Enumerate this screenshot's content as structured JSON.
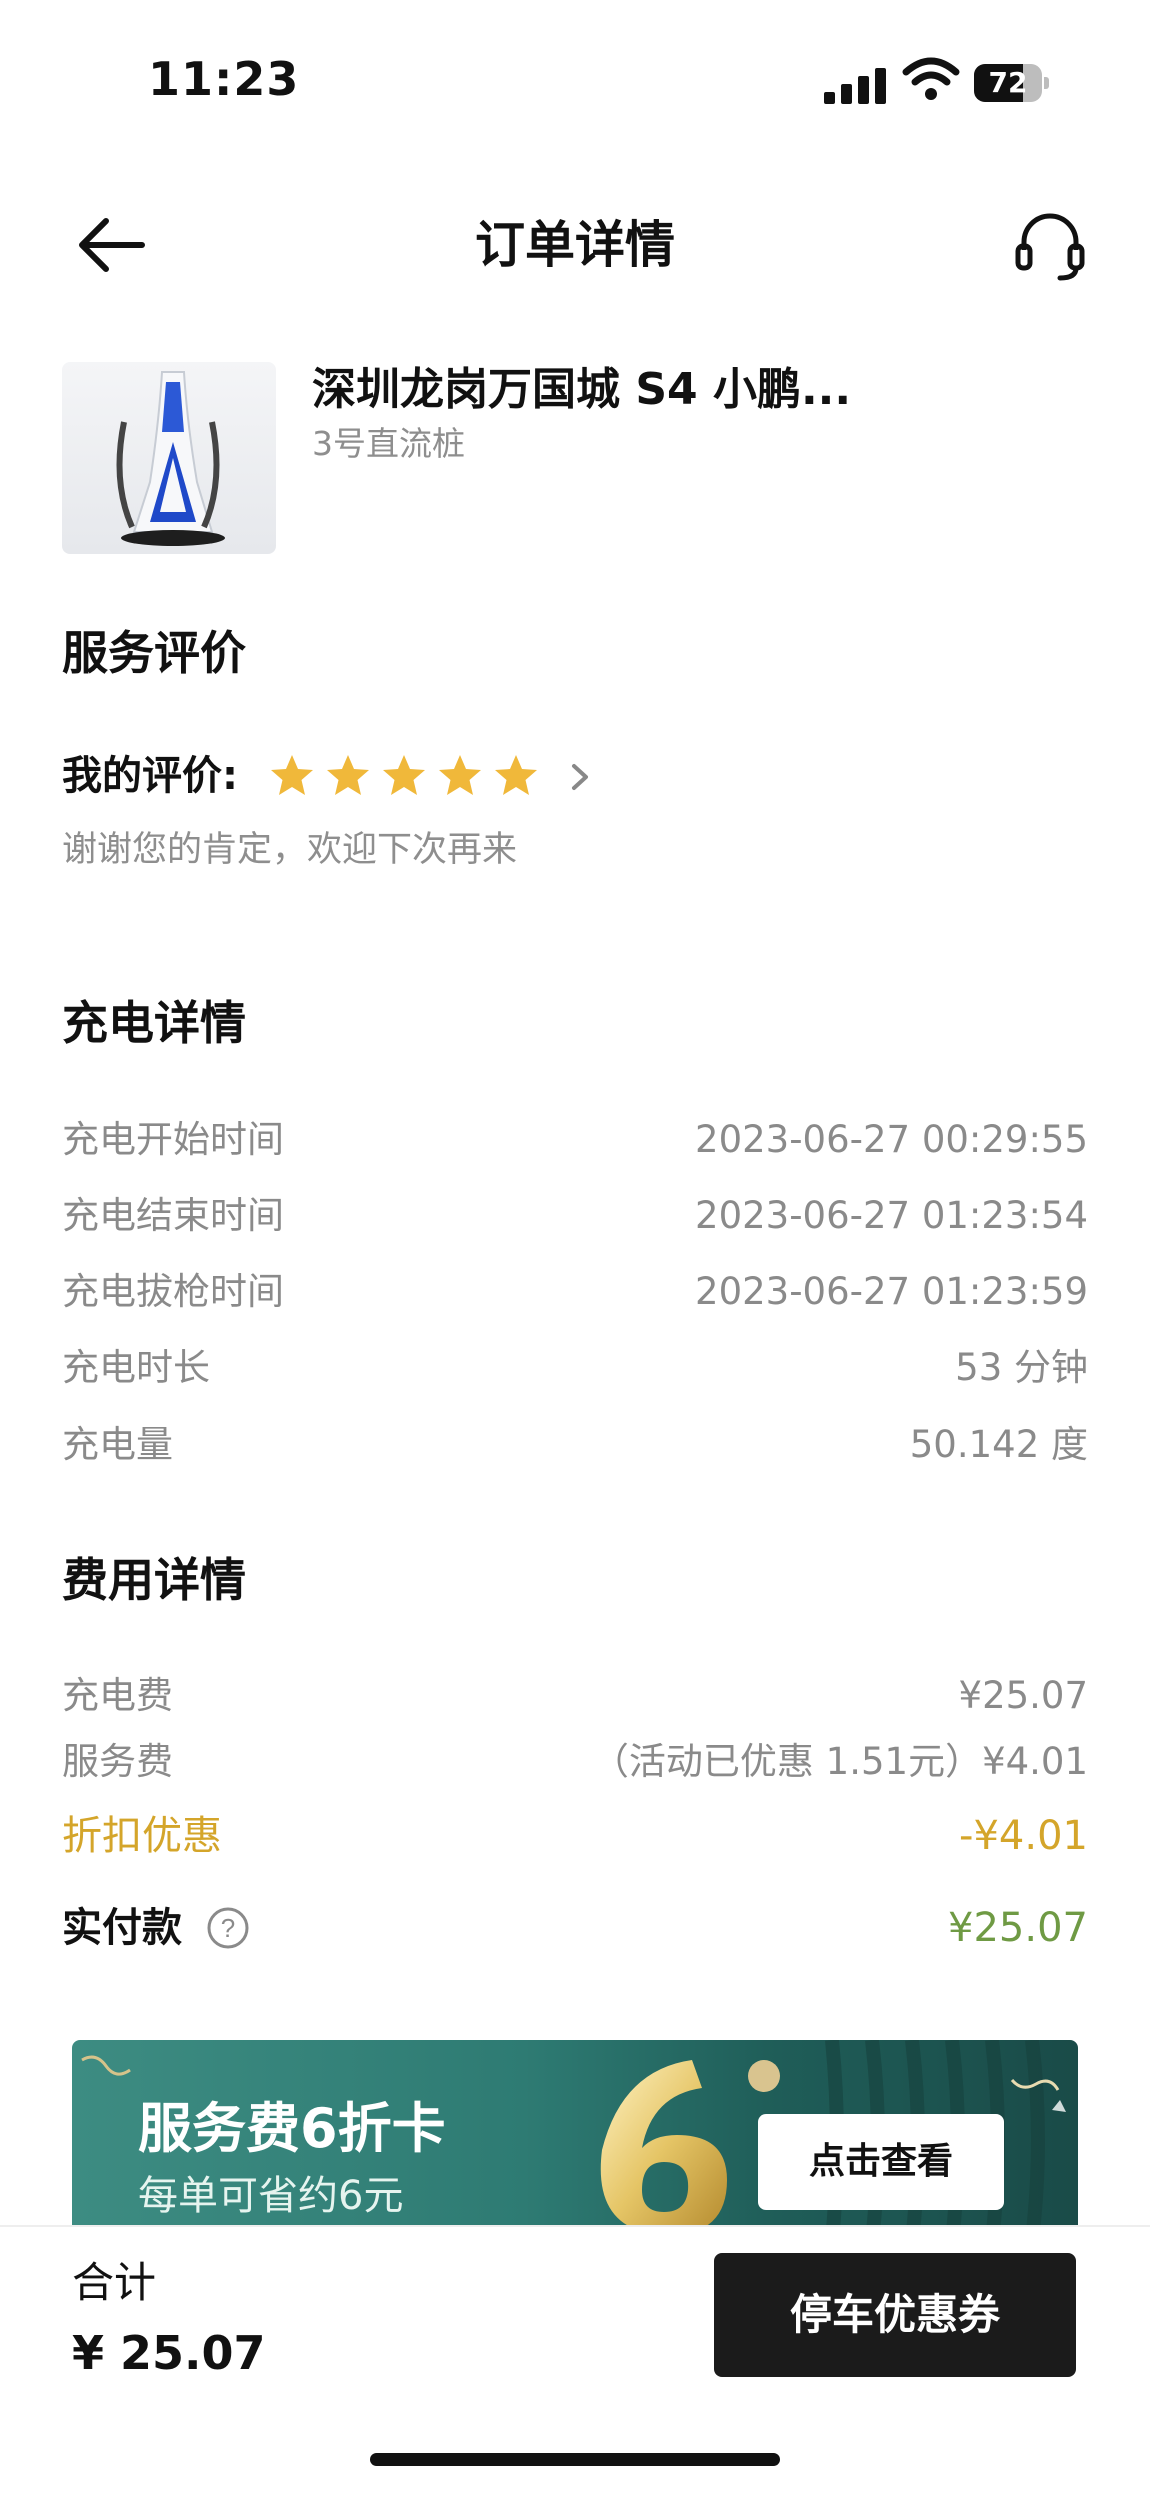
{
  "status_bar": {
    "time": "11:23",
    "battery": "72",
    "battery_level": 0.72
  },
  "nav": {
    "title": "订单详情",
    "back_icon": "back-arrow-icon",
    "support_icon": "headset-icon"
  },
  "station": {
    "name": "深圳龙岗万国城 S4 小鹏...",
    "pile": "3号直流桩"
  },
  "review": {
    "section_title": "服务评价",
    "label": "我的评价:",
    "stars": 5,
    "max_stars": 5,
    "note": "谢谢您的肯定，欢迎下次再来"
  },
  "charging": {
    "section_title": "充电详情",
    "rows": [
      {
        "label": "充电开始时间",
        "value": "2023-06-27 00:29:55"
      },
      {
        "label": "充电结束时间",
        "value": "2023-06-27 01:23:54"
      },
      {
        "label": "充电拔枪时间",
        "value": "2023-06-27 01:23:59"
      },
      {
        "label": "充电时长",
        "value": "53 分钟"
      },
      {
        "label": "充电量",
        "value": "50.142 度"
      }
    ]
  },
  "fees": {
    "section_title": "费用详情",
    "rows": [
      {
        "label": "充电费",
        "value": "¥25.07"
      },
      {
        "label": "服务费",
        "value": "（活动已优惠 1.51元）¥4.01"
      },
      {
        "label": "折扣优惠",
        "value": "-¥4.01"
      }
    ],
    "paid_label": "实付款",
    "paid_value": "¥25.07",
    "help_icon_text": "?"
  },
  "banner": {
    "title": "服务费6折卡",
    "subtitle": "每单可省约6元",
    "button": "点击查看"
  },
  "bottom": {
    "total_label": "合计",
    "total_value": "¥ 25.07",
    "button": "停车优惠券"
  },
  "colors": {
    "discount": "#d4a52a",
    "paid": "#6f9a44",
    "star": "#f0b83a",
    "dark_button": "#1b1b1b",
    "banner_teal": "#2e7b73"
  }
}
